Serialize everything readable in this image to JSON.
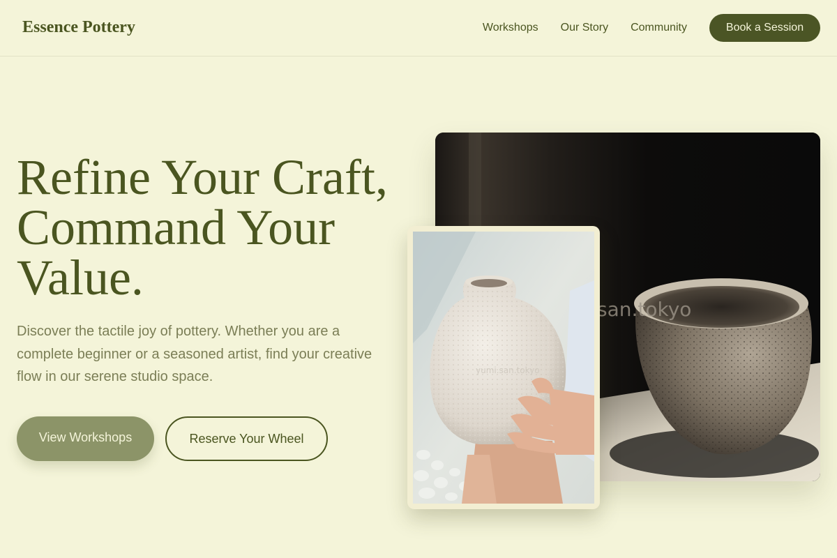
{
  "brand": {
    "name": "Essence Pottery"
  },
  "nav": {
    "links": [
      "Workshops",
      "Our Story",
      "Community"
    ],
    "cta": "Book a Session"
  },
  "hero": {
    "title_lines": [
      "Refine Your Craft,",
      "Command Your",
      "Value."
    ],
    "description": "Discover the tactile joy of pottery. Whether you are a complete beginner or a seasoned artist, find your creative flow in our serene studio space.",
    "primary_cta": "View Workshops",
    "secondary_cta": "Reserve Your Wheel"
  },
  "images": {
    "large_watermark": "san.tokyo",
    "small_watermark": "yumi.san.tokyo"
  },
  "colors": {
    "background": "#f4f4d9",
    "primary": "#4b5525",
    "muted_green": "#8c9468",
    "text_muted": "#7b7e56"
  },
  "icons": [
    "large-pottery-photo",
    "small-pottery-photo"
  ]
}
